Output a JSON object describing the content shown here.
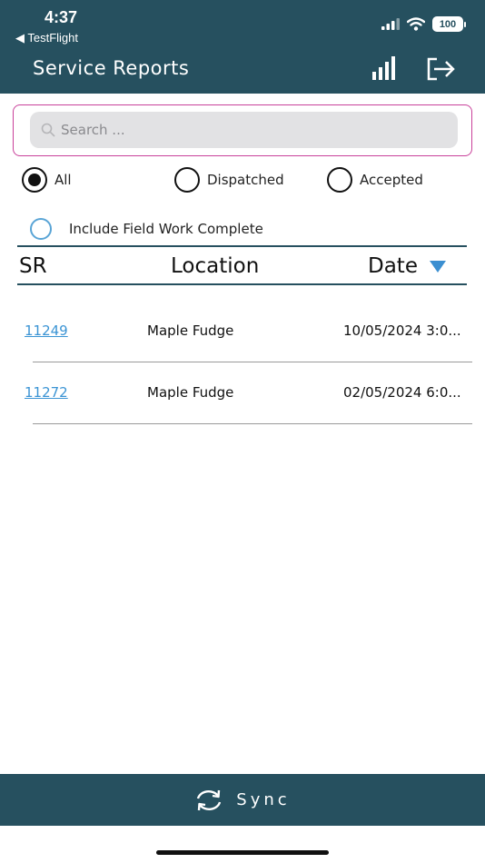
{
  "status_bar": {
    "time": "4:37",
    "back_app": "◀ TestFlight",
    "battery": "100"
  },
  "header": {
    "title": "Service Reports"
  },
  "search": {
    "placeholder": "Search ..."
  },
  "filters": {
    "options": [
      {
        "label": "All",
        "selected": true
      },
      {
        "label": "Dispatched",
        "selected": false
      },
      {
        "label": "Accepted",
        "selected": false
      }
    ],
    "include_field_work_complete": {
      "label": "Include Field Work Complete",
      "selected": false
    }
  },
  "table": {
    "columns": [
      "SR",
      "Location",
      "Date"
    ],
    "sort": {
      "column": "Date",
      "direction": "descending"
    },
    "rows": [
      {
        "sr": "11249",
        "location": "Maple Fudge",
        "date": "10/05/2024 3:0..."
      },
      {
        "sr": "11272",
        "location": "Maple Fudge",
        "date": "02/05/2024 6:0..."
      }
    ]
  },
  "footer": {
    "sync_label": "Sync"
  },
  "colors": {
    "header_bg": "#26505f",
    "link": "#3b94d4",
    "search_border": "#c9419a",
    "sort_arrow": "#3b8fd1"
  }
}
